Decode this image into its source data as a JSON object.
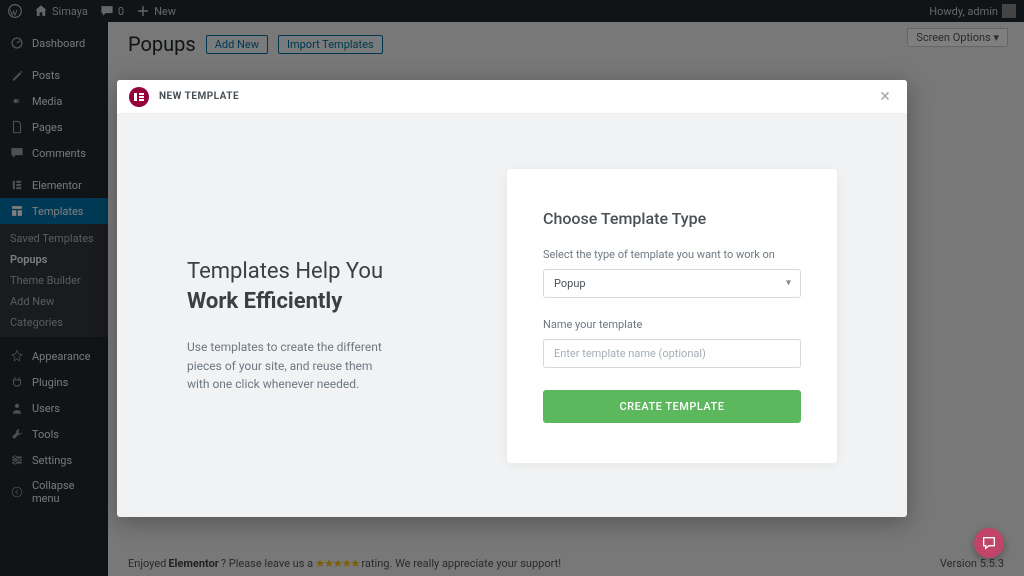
{
  "topbar": {
    "site_name": "Simaya",
    "comments_count": "0",
    "new_label": "New",
    "howdy": "Howdy, admin"
  },
  "sidebar": {
    "dashboard": "Dashboard",
    "posts": "Posts",
    "media": "Media",
    "pages": "Pages",
    "comments": "Comments",
    "elementor": "Elementor",
    "templates": "Templates",
    "sub": {
      "saved": "Saved Templates",
      "popups": "Popups",
      "theme_builder": "Theme Builder",
      "add_new": "Add New",
      "categories": "Categories"
    },
    "appearance": "Appearance",
    "plugins": "Plugins",
    "users": "Users",
    "tools": "Tools",
    "settings": "Settings",
    "collapse": "Collapse menu"
  },
  "page": {
    "title": "Popups",
    "add_new": "Add New",
    "import_templates": "Import Templates",
    "screen_options": "Screen Options"
  },
  "footer": {
    "prefix": "Enjoyed ",
    "brand": "Elementor",
    "mid": "? Please leave us a ",
    "stars": "★★★★★",
    "suffix": " rating. We really appreciate your support!",
    "version": "Version 5.5.3"
  },
  "modal": {
    "header": "NEW TEMPLATE",
    "intro_line1": "Templates Help You",
    "intro_line2": "Work Efficiently",
    "intro_body": "Use templates to create the different pieces of your site, and reuse them with one click whenever needed.",
    "card_title": "Choose Template Type",
    "type_label": "Select the type of template you want to work on",
    "type_value": "Popup",
    "name_label": "Name your template",
    "name_placeholder": "Enter template name (optional)",
    "create_button": "CREATE TEMPLATE"
  }
}
